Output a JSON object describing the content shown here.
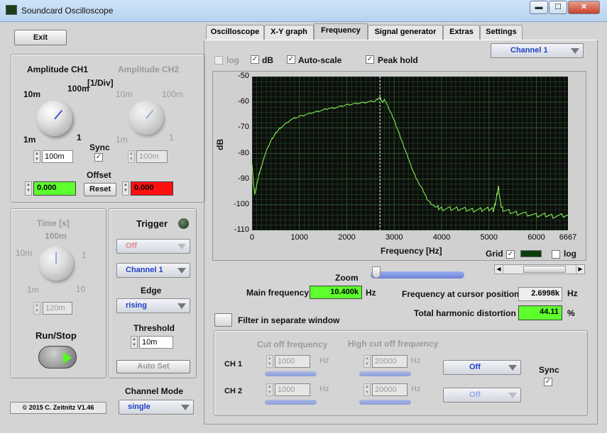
{
  "window": {
    "title": "Soundcard Oscilloscope"
  },
  "exit_label": "Exit",
  "amp": {
    "ch1": "Amplitude CH1",
    "ch2": "Amplitude CH2",
    "unit": "[1/Div]",
    "k10m": "10m",
    "k100m": "100m",
    "k1m": "1m",
    "k1": "1",
    "ch1_value": "100m",
    "ch2_value": "100m",
    "sync": "Sync",
    "offset": "Offset",
    "ch1_offset": "0.000",
    "ch2_offset": "0.000",
    "reset": "Reset"
  },
  "time": {
    "title": "Time [s]",
    "k100m": "100m",
    "k10m": "10m",
    "k1": "1",
    "k1m": "1m",
    "k10": "10",
    "value": "120m"
  },
  "trigger": {
    "title": "Trigger",
    "mode": "Off",
    "channel": "Channel 1",
    "edge_label": "Edge",
    "edge": "rising",
    "threshold_label": "Threshold",
    "threshold": "10m",
    "autoset": "Auto Set"
  },
  "runstop": "Run/Stop",
  "channel_mode": {
    "label": "Channel Mode",
    "value": "single"
  },
  "copyright": "© 2015  C. Zeitnitz V1.46",
  "tabs": [
    "Oscilloscope",
    "X-Y graph",
    "Frequency",
    "Signal generator",
    "Extras",
    "Settings"
  ],
  "options": {
    "log": "log",
    "db": "dB",
    "autoscale": "Auto-scale",
    "peakhold": "Peak hold"
  },
  "channel_select": "Channel 1",
  "chart_data": {
    "type": "line",
    "xlabel": "Frequency [Hz]",
    "ylabel": "dB",
    "xlim": [
      0,
      6667
    ],
    "ylim": [
      -110,
      -50
    ],
    "xticks": [
      "0",
      "1000",
      "2000",
      "3000",
      "4000",
      "5000",
      "6000",
      "6667"
    ],
    "yticks": [
      "-50",
      "-60",
      "-70",
      "-80",
      "-90",
      "-100",
      "-110"
    ],
    "cursor_x": 2700,
    "grid": true,
    "colors": {
      "background": "#0d0d0d",
      "grid": "#2a5a2a",
      "line": "#8cff5a",
      "cursor": "#ffffff"
    },
    "series": [
      {
        "x": [
          0,
          30,
          60,
          100,
          150,
          200,
          300,
          400,
          500,
          600,
          800,
          1000,
          1200,
          1400,
          1600,
          1800,
          2000,
          2200,
          2400,
          2600,
          2700,
          2750,
          2800,
          2900,
          3000,
          3100,
          3200,
          3300,
          3400,
          3500,
          3600,
          3700,
          3800,
          3900,
          4000,
          4200,
          4400,
          4600,
          4800,
          5000,
          5100,
          5150,
          5200,
          5250,
          5300,
          5500,
          5700,
          6000,
          6200,
          6400,
          6667
        ],
        "y": [
          -84,
          -92,
          -96,
          -92,
          -88,
          -85,
          -79,
          -75,
          -72,
          -70,
          -67,
          -65.5,
          -64.5,
          -63.5,
          -62.5,
          -62,
          -61,
          -60.5,
          -60,
          -59.5,
          -58,
          -60,
          -59,
          -63,
          -67,
          -72,
          -77,
          -82,
          -87,
          -91,
          -94,
          -98,
          -100,
          -101,
          -101.5,
          -101.5,
          -101.5,
          -102,
          -102,
          -101.5,
          -102,
          -98,
          -93,
          -100,
          -102,
          -103,
          -103.5,
          -104,
          -104,
          -104.5,
          -104
        ]
      }
    ]
  },
  "grid_ctrl": {
    "grid": "Grid",
    "log": "log"
  },
  "zoom": "Zoom",
  "main_freq": {
    "label": "Main frequency",
    "value": "10.400k",
    "unit": "Hz"
  },
  "cursor_freq": {
    "label": "Frequency at cursor position",
    "value": "2.6998k",
    "unit": "Hz"
  },
  "thd": {
    "label": "Total harmonic distortion",
    "value": "44.11",
    "unit": "%"
  },
  "filter_window": "Filter in separate window",
  "filter": {
    "cutoff": "Cut off frequency",
    "highcut": "High cut off frequency",
    "ch1": "CH 1",
    "ch2": "CH 2",
    "ch1_cut": "1000",
    "ch2_cut": "1000",
    "ch1_high": "20000",
    "ch2_high": "20000",
    "hz": "Hz",
    "ch1_mode": "Off",
    "ch2_mode": "Off",
    "sync": "Sync"
  }
}
